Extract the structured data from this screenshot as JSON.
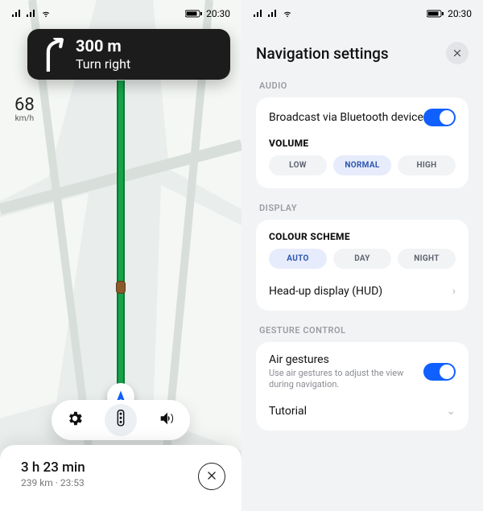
{
  "status": {
    "time": "20:30"
  },
  "nav": {
    "turn": {
      "distance": "300 m",
      "instruction": "Turn right"
    },
    "speed": {
      "value": "68",
      "unit": "km/h"
    },
    "eta": {
      "duration": "3 h 23 min",
      "sub": "239 km · 23:53"
    }
  },
  "settings": {
    "title": "Navigation settings",
    "sections": {
      "audio": {
        "label": "AUDIO"
      },
      "display": {
        "label": "DISPLAY"
      },
      "gesture": {
        "label": "GESTURE CONTROL"
      }
    },
    "bluetooth": {
      "label": "Broadcast via Bluetooth device"
    },
    "volume": {
      "title": "VOLUME",
      "options": {
        "low": "LOW",
        "normal": "NORMAL",
        "high": "HIGH"
      }
    },
    "scheme": {
      "title": "COLOUR SCHEME",
      "options": {
        "auto": "AUTO",
        "day": "DAY",
        "night": "NIGHT"
      }
    },
    "hud": {
      "label": "Head-up display (HUD)"
    },
    "air": {
      "label": "Air gestures",
      "sub": "Use air gestures to adjust the view during navigation."
    },
    "tutorial": {
      "label": "Tutorial"
    }
  }
}
